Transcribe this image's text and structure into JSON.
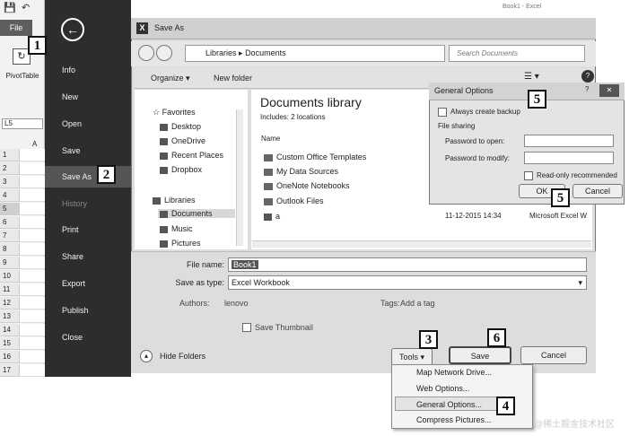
{
  "excel": {
    "file_tab": "File",
    "pivot_label": "PivotTable",
    "namebox": "L5",
    "column_a": "A",
    "rows": [
      "1",
      "2",
      "3",
      "4",
      "5",
      "6",
      "7",
      "8",
      "9",
      "10",
      "11",
      "12",
      "13",
      "14",
      "15",
      "16",
      "17"
    ]
  },
  "backstage": {
    "items": [
      "Info",
      "New",
      "Open",
      "Save",
      "Save As",
      "History",
      "Print",
      "Share",
      "Export",
      "Publish",
      "Close"
    ]
  },
  "badges": [
    "1",
    "2",
    "3",
    "4",
    "5",
    "5",
    "6"
  ],
  "dialog": {
    "title": "Save As",
    "window_title": "Book1 - Excel",
    "address": [
      "Libraries",
      "Documents"
    ],
    "search_placeholder": "Search Documents",
    "organize": "Organize",
    "new_folder": "New folder",
    "nav_pane": {
      "favorites": "Favorites",
      "favorites_items": [
        "Desktop",
        "OneDrive",
        "Recent Places",
        "Dropbox"
      ],
      "libraries": "Libraries",
      "libraries_items": [
        "Documents",
        "Music",
        "Pictures"
      ]
    },
    "library_title": "Documents library",
    "library_includes": "Includes: 2 locations",
    "column_name": "Name",
    "files": [
      "Custom Office Templates",
      "My Data Sources",
      "OneNote Notebooks",
      "Outlook Files",
      "a"
    ],
    "file_date": "11-12-2015 14:34",
    "file_type": "Microsoft Excel W",
    "file_name_label": "File name:",
    "file_name_value": "Book1",
    "save_type_label": "Save as type:",
    "save_type_value": "Excel Workbook",
    "authors_label": "Authors:",
    "authors_value": "lenovo",
    "tags_label": "Tags:",
    "tags_value": "Add a tag",
    "save_thumbnail": "Save Thumbnail",
    "hide_folders": "Hide Folders",
    "tools": "Tools",
    "save": "Save",
    "cancel": "Cancel"
  },
  "tools_menu": [
    "Map Network Drive...",
    "Web Options...",
    "General Options...",
    "Compress Pictures..."
  ],
  "general_options": {
    "title": "General Options",
    "always_backup": "Always create backup",
    "file_sharing": "File sharing",
    "password_open": "Password to open:",
    "password_modify": "Password to modify:",
    "read_only": "Read-only recommended",
    "ok": "OK",
    "cancel": "Cancel"
  },
  "watermark": "@稀土掘金技术社区"
}
